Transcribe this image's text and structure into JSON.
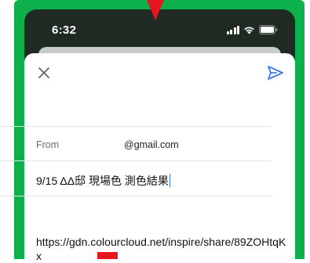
{
  "status_bar": {
    "time": "6:32"
  },
  "compose": {
    "close_icon": "close-icon",
    "send_icon": "send-icon",
    "from_label": "From",
    "from_value": "@gmail.com",
    "subject": "9/15 ΔΔ邸 現場色 測色結果",
    "body": "https://gdn.colourcloud.net/inspire/share/89ZOHtqKx"
  },
  "colors": {
    "frame_border": "#0db14b",
    "marker": "#e8141e",
    "accent": "#3b7bea",
    "phone_bg": "#1e2a22"
  }
}
